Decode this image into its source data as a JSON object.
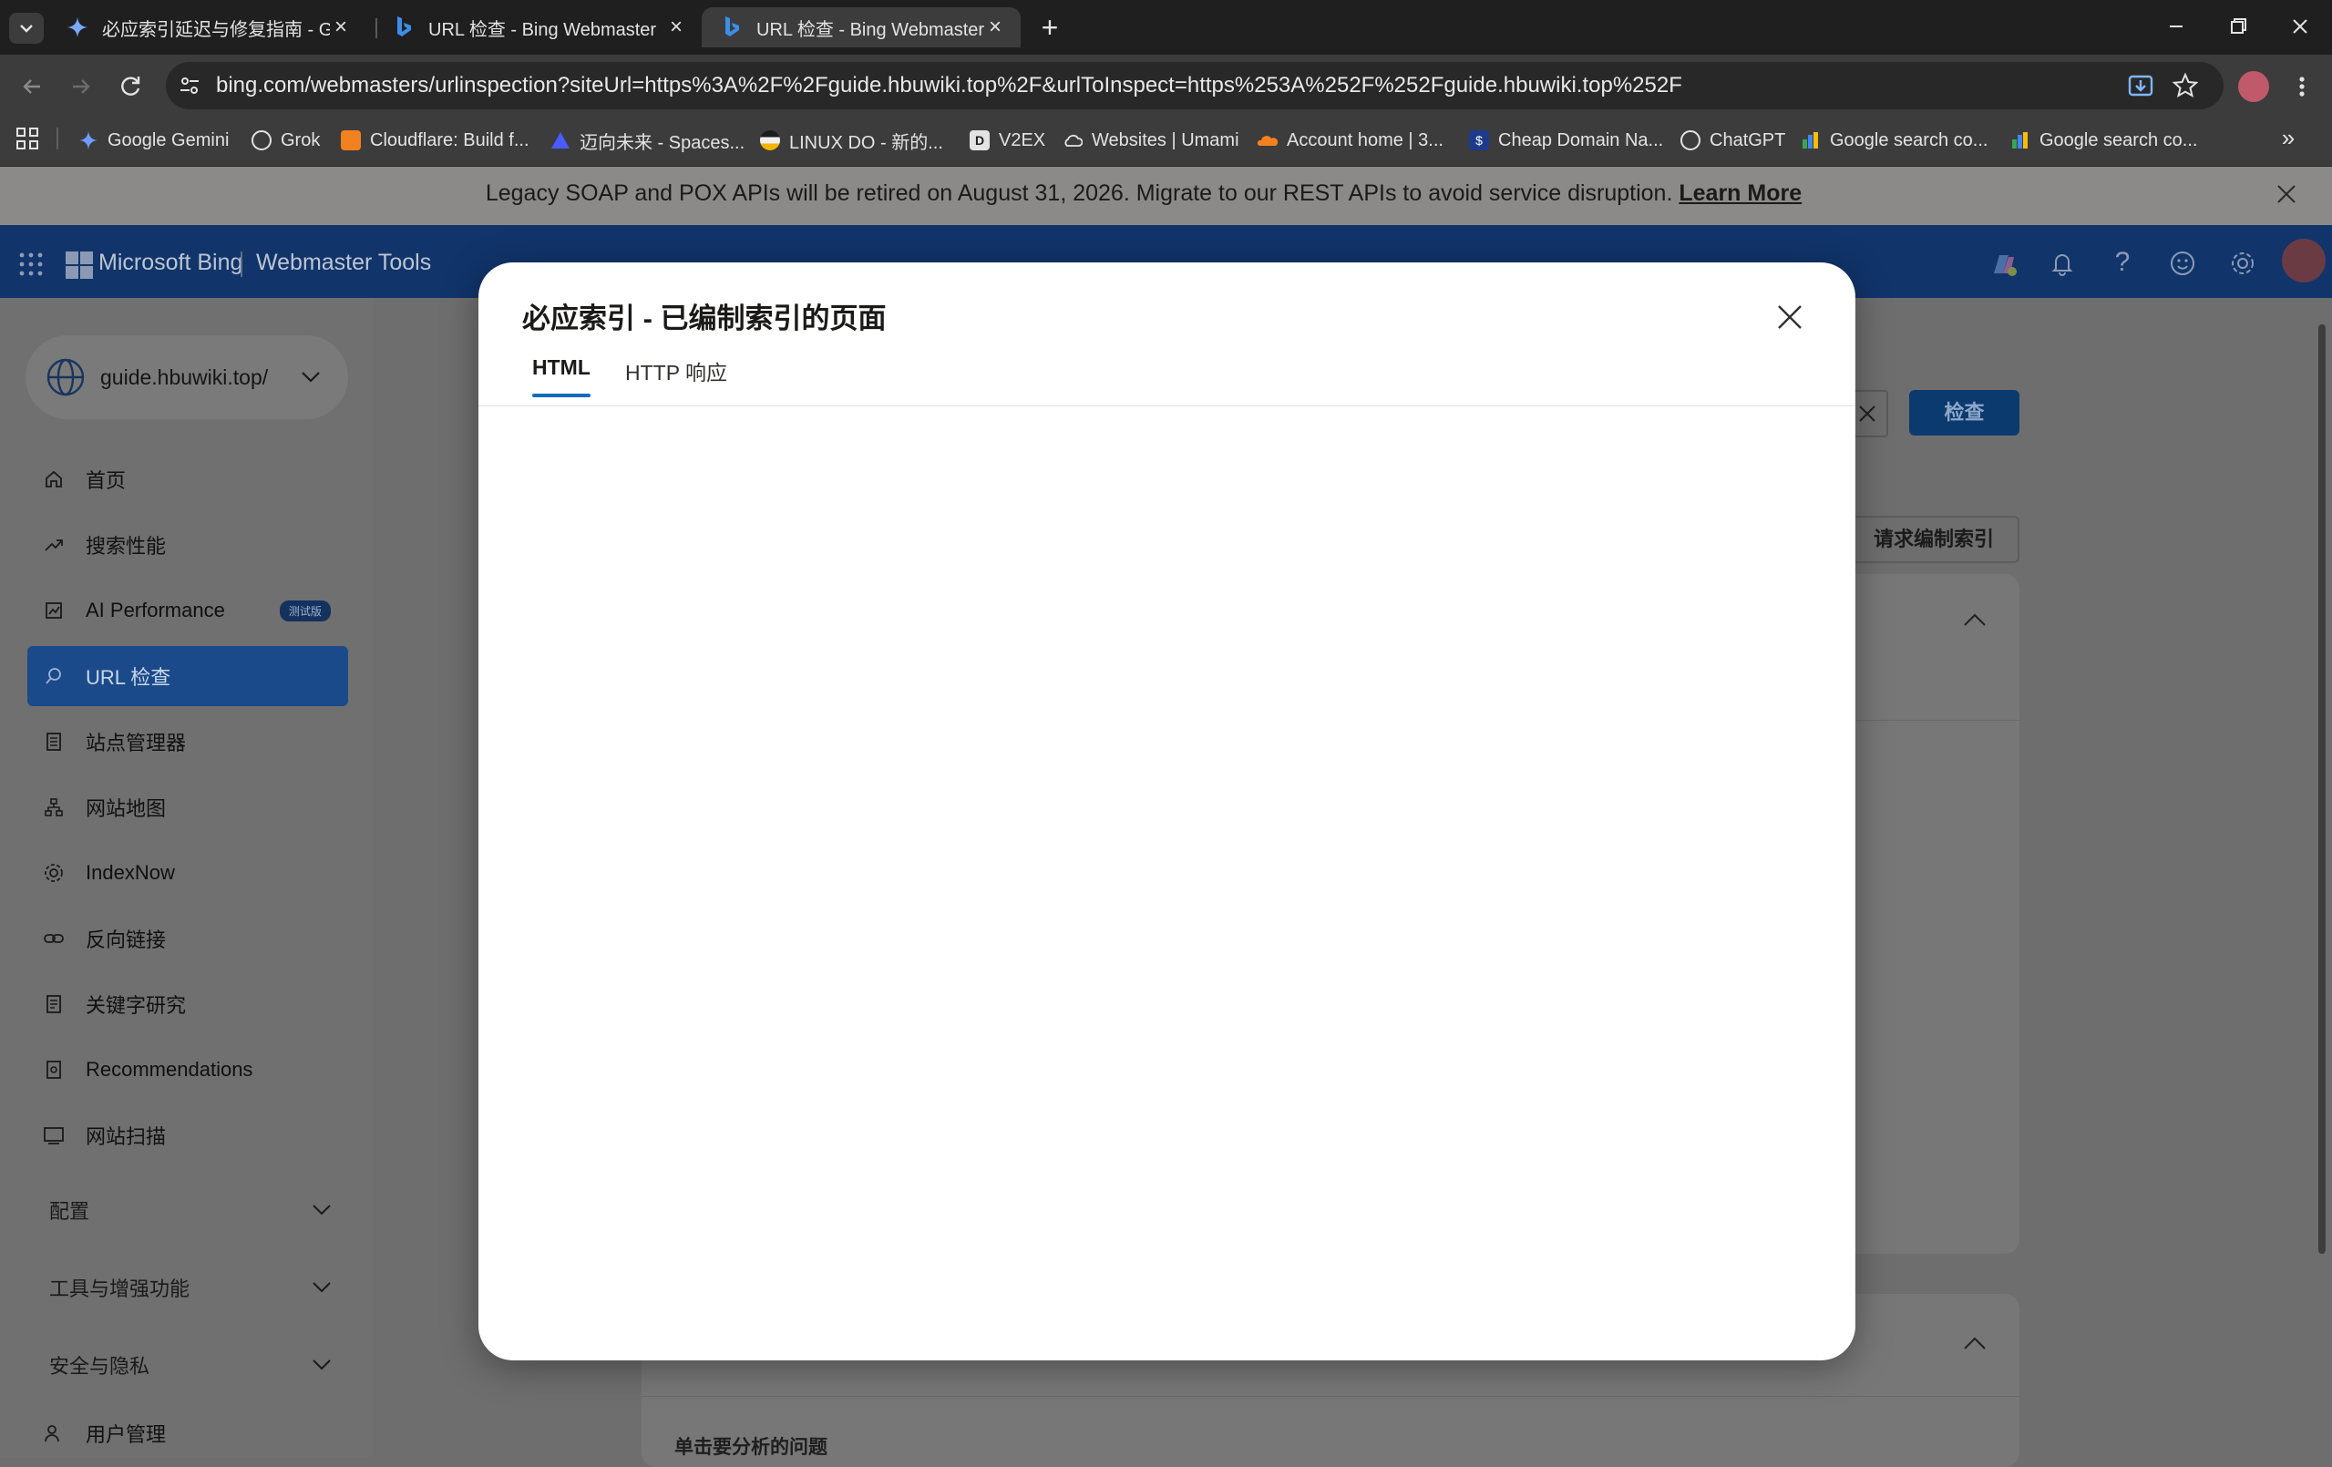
{
  "browser": {
    "tabs": [
      {
        "title": "必应索引延迟与修复指南 - Goo",
        "icon": "gemini-icon",
        "active": false
      },
      {
        "title": "URL 检查 - Bing Webmaster T",
        "icon": "bing-icon",
        "active": false
      },
      {
        "title": "URL 检查 - Bing Webmaster T",
        "icon": "bing-icon",
        "active": true
      }
    ],
    "address": "bing.com/webmasters/urlinspection?siteUrl=https%3A%2F%2Fguide.hbuwiki.top%2F&urlToInspect=https%253A%252F%252Fguide.hbuwiki.top%252F",
    "bookmarks": [
      {
        "label": "Google Gemini",
        "icon": "gemini-icon"
      },
      {
        "label": "Grok",
        "icon": "grok-icon"
      },
      {
        "label": "Cloudflare: Build f...",
        "icon": "cloudflare-icon"
      },
      {
        "label": "迈向未来 - Spaces...",
        "icon": "spaces-icon"
      },
      {
        "label": "LINUX DO - 新的...",
        "icon": "linuxdo-icon"
      },
      {
        "label": "V2EX",
        "icon": "v2ex-icon"
      },
      {
        "label": "Websites | Umami",
        "icon": "umami-icon"
      },
      {
        "label": "Account home | 3...",
        "icon": "cloudflare-icon"
      },
      {
        "label": "Cheap Domain Na...",
        "icon": "domain-icon"
      },
      {
        "label": "ChatGPT",
        "icon": "chatgpt-icon"
      },
      {
        "label": "Google search co...",
        "icon": "search-console-icon"
      },
      {
        "label": "Google search co...",
        "icon": "search-console-icon"
      }
    ]
  },
  "notice": {
    "text": "Legacy SOAP and POX APIs will be retired on August 31, 2026. Migrate to our REST APIs to avoid service disruption.",
    "link": "Learn More"
  },
  "header": {
    "brand": "Microsoft Bing",
    "product": "Webmaster Tools"
  },
  "sidebar": {
    "site": "guide.hbuwiki.top/",
    "items": [
      {
        "label": "首页",
        "icon": "home-icon"
      },
      {
        "label": "搜索性能",
        "icon": "trend-icon"
      },
      {
        "label": "AI Performance",
        "icon": "chart-icon",
        "badge": "测试版"
      },
      {
        "label": "URL 检查",
        "icon": "search-icon",
        "active": true
      },
      {
        "label": "站点管理器",
        "icon": "document-icon"
      },
      {
        "label": "网站地图",
        "icon": "sitemap-icon"
      },
      {
        "label": "IndexNow",
        "icon": "gear-icon"
      },
      {
        "label": "反向链接",
        "icon": "link-icon"
      },
      {
        "label": "关键字研究",
        "icon": "document-icon"
      },
      {
        "label": "Recommendations",
        "icon": "recommend-icon"
      },
      {
        "label": "网站扫描",
        "icon": "scan-icon"
      }
    ],
    "sections": [
      "配置",
      "工具与增强功能",
      "安全与隐私"
    ],
    "footer_item": "用户管理"
  },
  "main": {
    "inspect_button": "检查",
    "request_index_button": "请求编制索引",
    "analyze_prompt": "单击要分析的问题"
  },
  "modal": {
    "title": "必应索引 - 已编制索引的页面",
    "tabs": [
      "HTML",
      "HTTP 响应"
    ],
    "active_tab": "HTML"
  },
  "colors": {
    "accent": "#0f6cbd",
    "header_bg": "#11346a",
    "overlay_gray": "#707070"
  }
}
